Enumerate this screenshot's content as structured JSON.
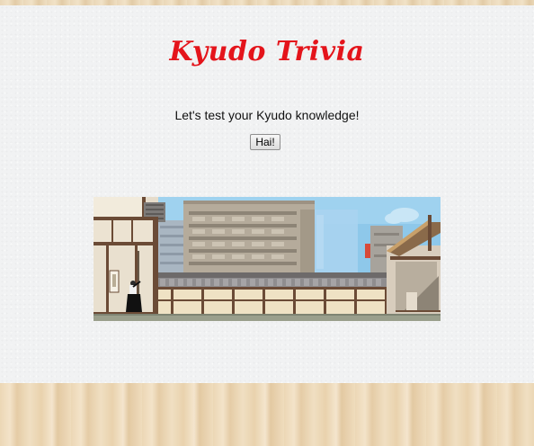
{
  "app": {
    "title": "Kyudo Trivia",
    "subtitle": "Let's test your Kyudo knowledge!",
    "start_button_label": "Hai!"
  },
  "scene": {
    "description_icon": "kyudo-dojo-illustration",
    "colors": {
      "title": "#e4141b",
      "sky": "#8ec8ea",
      "building": "#b4ab9b"
    }
  }
}
